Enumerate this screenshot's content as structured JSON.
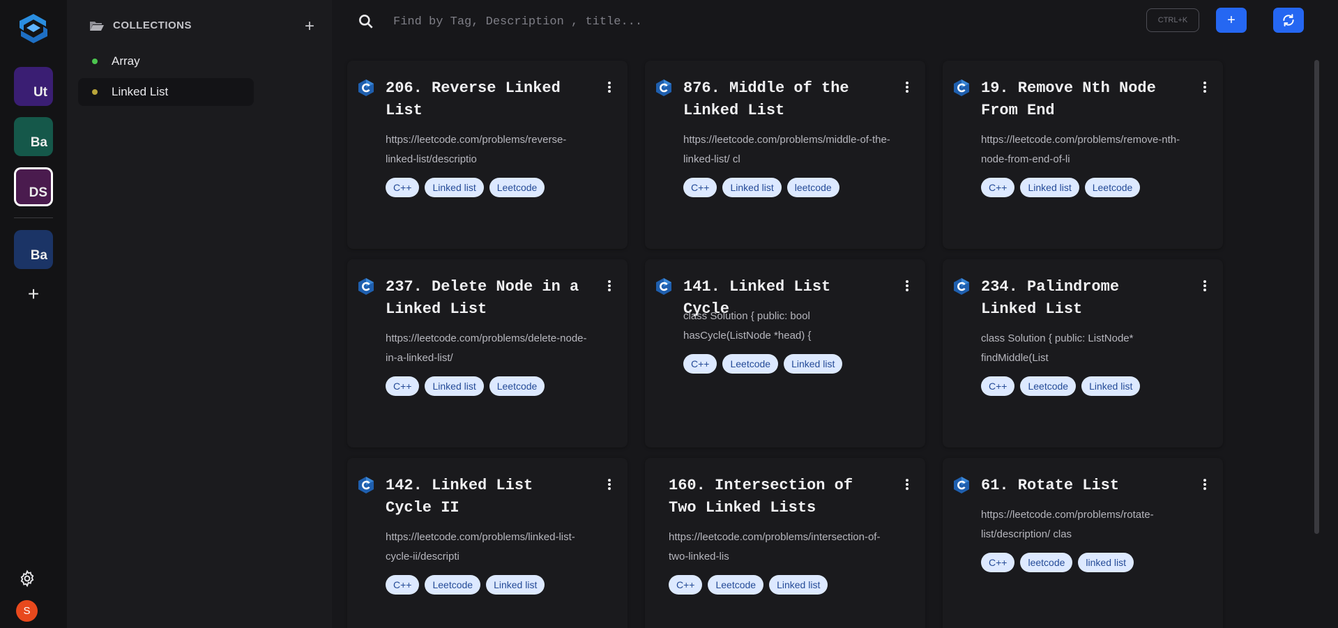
{
  "rail": {
    "workspaces": [
      {
        "initials": "Ut",
        "color": "#3a1e73",
        "active": false
      },
      {
        "initials": "Ba",
        "color": "#15584a",
        "active": false
      },
      {
        "initials": "DS",
        "color": "#4a1b4e",
        "active": true
      },
      {
        "initials": "Ba",
        "color": "#1b3466",
        "active": false
      }
    ],
    "add_label": "+",
    "avatar_initial": "S"
  },
  "collections": {
    "title": "COLLECTIONS",
    "add_label": "+",
    "items": [
      {
        "label": "Array",
        "dot": "#4cc54f",
        "active": false
      },
      {
        "label": "Linked List",
        "dot": "#b9a53a",
        "active": true
      }
    ]
  },
  "search": {
    "placeholder": "Find by Tag, Description , title...",
    "shortcut": "CTRL+K"
  },
  "toolbar": {
    "add_label": "+"
  },
  "colors": {
    "accent": "#2567f2",
    "tag_bg": "#dde9ff",
    "tag_text": "#254b97"
  },
  "cards": [
    {
      "title": "206. Reverse Linked List",
      "desc": "https://leetcode.com/problems/reverse-linked-list/descriptio",
      "tags": [
        "C++",
        "Linked list",
        "Leetcode"
      ],
      "icon": true
    },
    {
      "title": "876. Middle of the Linked List",
      "desc": "https://leetcode.com/problems/middle-of-the-linked-list/ cl",
      "tags": [
        "C++",
        "Linked list",
        "leetcode"
      ],
      "icon": true
    },
    {
      "title": "19. Remove Nth Node From End",
      "desc": "https://leetcode.com/problems/remove-nth-node-from-end-of-li",
      "tags": [
        "C++",
        "Linked list",
        "Leetcode"
      ],
      "icon": true
    },
    {
      "title": "237. Delete Node in a Linked List",
      "desc": "https://leetcode.com/problems/delete-node-in-a-linked-list/",
      "tags": [
        "C++",
        "Linked list",
        "Leetcode"
      ],
      "icon": true
    },
    {
      "title": "141. Linked List Cycle",
      "desc": "class Solution { public: bool hasCycle(ListNode *head) {",
      "tags": [
        "C++",
        "Leetcode",
        "Linked list"
      ],
      "icon": true
    },
    {
      "title": "234. Palindrome Linked List",
      "desc": "class Solution { public: ListNode* findMiddle(List",
      "tags": [
        "C++",
        "Leetcode",
        "Linked list"
      ],
      "icon": true
    },
    {
      "title": "142. Linked List Cycle II",
      "desc": "https://leetcode.com/problems/linked-list-cycle-ii/descripti",
      "tags": [
        "C++",
        "Leetcode",
        "Linked list"
      ],
      "icon": true
    },
    {
      "title": "160. Intersection of Two Linked Lists",
      "desc": "https://leetcode.com/problems/intersection-of-two-linked-lis",
      "tags": [
        "C++",
        "Leetcode",
        "Linked list"
      ],
      "icon": false
    },
    {
      "title": "61. Rotate List",
      "desc": "https://leetcode.com/problems/rotate-list/description/ clas",
      "tags": [
        "C++",
        "leetcode",
        "linked list"
      ],
      "icon": true
    }
  ]
}
